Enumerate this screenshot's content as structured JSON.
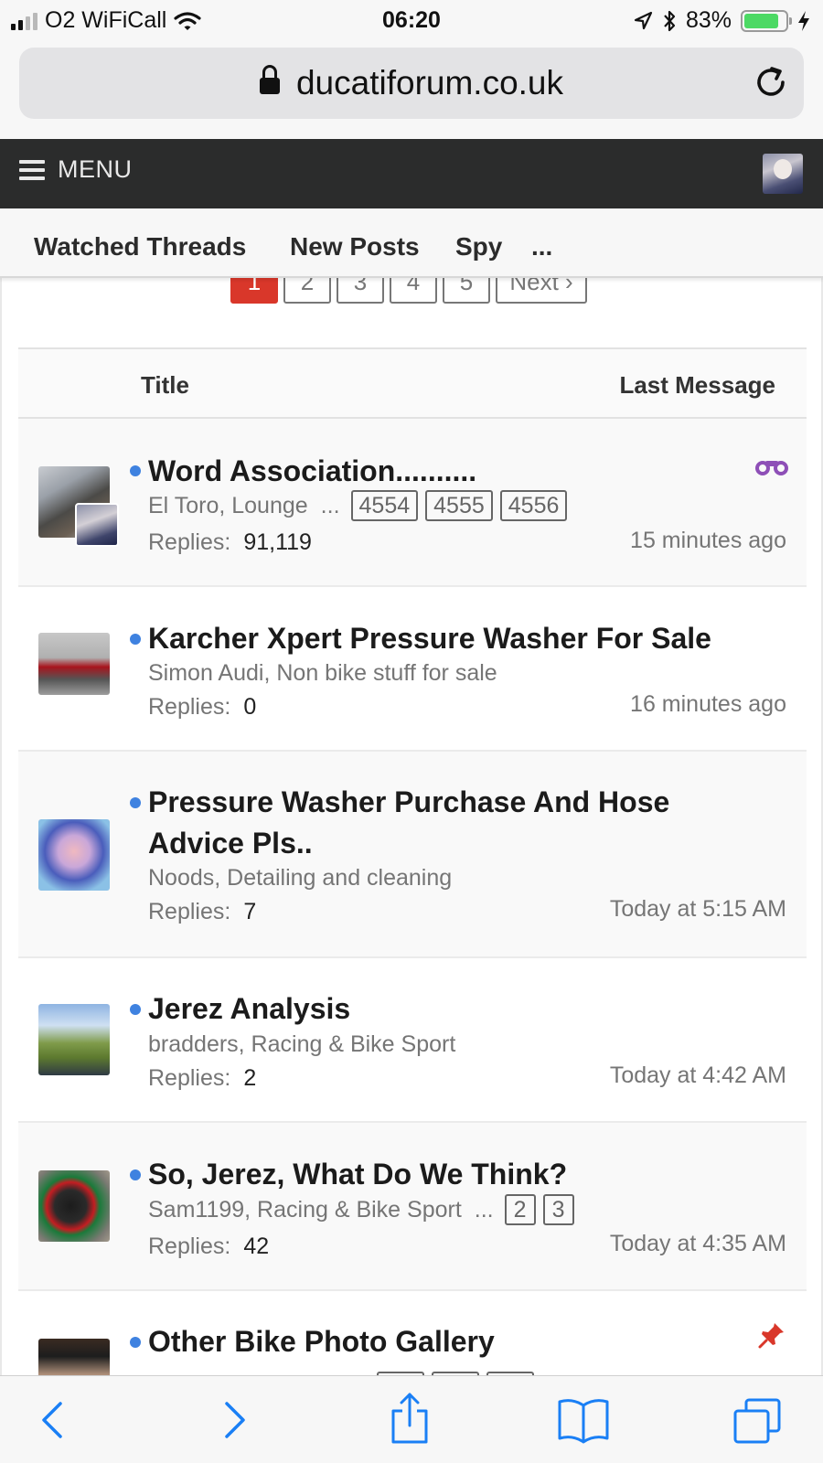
{
  "status_bar": {
    "carrier": "O2 WiFiCall",
    "time": "06:20",
    "battery_percent": "83%",
    "battery_level": 0.83,
    "battery_color": "#4cd964"
  },
  "browser": {
    "url": "ducatiforum.co.uk",
    "icons": [
      "lock-icon",
      "reload-icon"
    ]
  },
  "forum_header": {
    "menu_label": "MENU"
  },
  "subnav": {
    "items": [
      "Watched Threads",
      "New Posts",
      "Spy",
      "..."
    ]
  },
  "pagination": {
    "current": "1",
    "pages": [
      "2",
      "3",
      "4",
      "5"
    ],
    "next_label": "Next ›"
  },
  "table": {
    "col_title": "Title",
    "col_last": "Last Message",
    "replies_label": "Replies:",
    "threads": [
      {
        "title": "Word Association..........",
        "author_forum": "El Toro, Lounge",
        "ellipsis": "...",
        "pages": [
          "4554",
          "4555",
          "4556"
        ],
        "replies": "91,119",
        "last": "15 minutes ago",
        "status_icon": "watch-icon"
      },
      {
        "title": "Karcher Xpert Pressure Washer For Sale",
        "author_forum": "Simon Audi, Non bike stuff for sale",
        "replies": "0",
        "last": "16 minutes ago"
      },
      {
        "title": "Pressure Washer Purchase And Hose Advice Pls..",
        "author_forum": "Noods, Detailing and cleaning",
        "replies": "7",
        "last": "Today at 5:15 AM"
      },
      {
        "title": "Jerez Analysis",
        "author_forum": "bradders, Racing & Bike Sport",
        "replies": "2",
        "last": "Today at 4:42 AM"
      },
      {
        "title": "So, Jerez, What Do We Think?",
        "author_forum": "Sam1199, Racing & Bike Sport",
        "ellipsis": "...",
        "pages": [
          "2",
          "3"
        ],
        "replies": "42",
        "last": "Today at 4:35 AM"
      },
      {
        "title": "Other Bike Photo Gallery",
        "status_icon": "pin-icon"
      }
    ]
  },
  "colors": {
    "accent_red": "#d9372a",
    "unread_dot": "#3f82e0",
    "watch_purple": "#8e4fb7",
    "ios_blue": "#1a7ff5",
    "header_dark": "#2b2c2c"
  },
  "toolbar": {
    "icons": [
      "back-icon",
      "forward-icon",
      "share-icon",
      "bookmarks-icon",
      "tabs-icon"
    ]
  }
}
